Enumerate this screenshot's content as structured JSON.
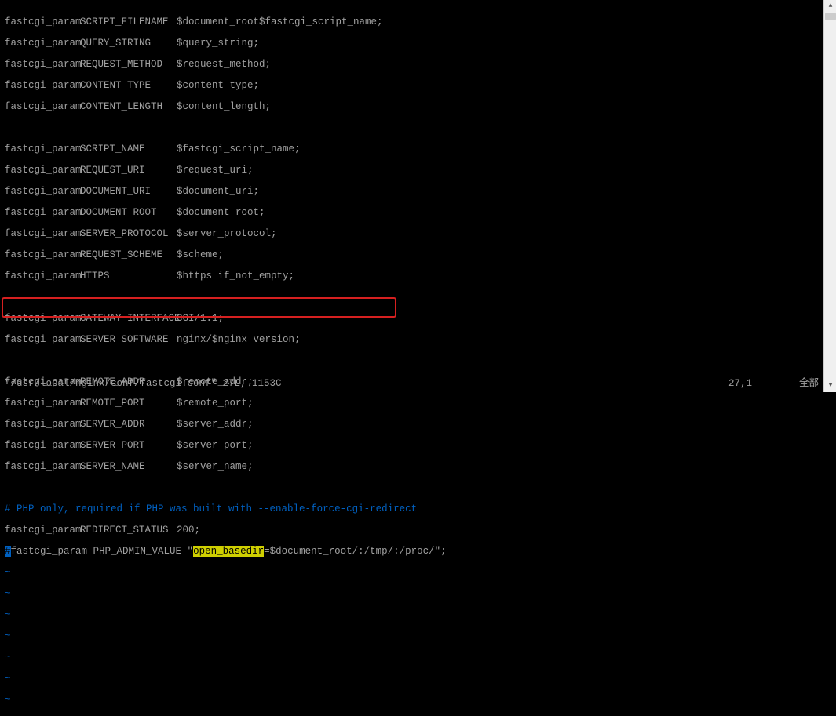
{
  "params": [
    {
      "k": "SCRIPT_FILENAME",
      "v": "$document_root$fastcgi_script_name;"
    },
    {
      "k": "QUERY_STRING",
      "v": "$query_string;"
    },
    {
      "k": "REQUEST_METHOD",
      "v": "$request_method;"
    },
    {
      "k": "CONTENT_TYPE",
      "v": "$content_type;"
    },
    {
      "k": "CONTENT_LENGTH",
      "v": "$content_length;"
    }
  ],
  "params2": [
    {
      "k": "SCRIPT_NAME",
      "v": "$fastcgi_script_name;"
    },
    {
      "k": "REQUEST_URI",
      "v": "$request_uri;"
    },
    {
      "k": "DOCUMENT_URI",
      "v": "$document_uri;"
    },
    {
      "k": "DOCUMENT_ROOT",
      "v": "$document_root;"
    },
    {
      "k": "SERVER_PROTOCOL",
      "v": "$server_protocol;"
    },
    {
      "k": "REQUEST_SCHEME",
      "v": "$scheme;"
    },
    {
      "k": "HTTPS",
      "v": "$https if_not_empty;"
    }
  ],
  "params3": [
    {
      "k": "GATEWAY_INTERFACE",
      "v": "CGI/1.1;"
    },
    {
      "k": "SERVER_SOFTWARE",
      "v": "nginx/$nginx_version;"
    }
  ],
  "params4": [
    {
      "k": "REMOTE_ADDR",
      "v": "$remote_addr;"
    },
    {
      "k": "REMOTE_PORT",
      "v": "$remote_port;"
    },
    {
      "k": "SERVER_ADDR",
      "v": "$server_addr;"
    },
    {
      "k": "SERVER_PORT",
      "v": "$server_port;"
    },
    {
      "k": "SERVER_NAME",
      "v": "$server_name;"
    }
  ],
  "directive": "fastcgi_param",
  "comment_line": "# PHP only, required if PHP was built with --enable-force-cgi-redirect",
  "redirect_line": {
    "k": "REDIRECT_STATUS",
    "v": "200;"
  },
  "edit_line": {
    "cursor_char": "#",
    "prefix": "fastcgi_param PHP_ADMIN_VALUE \"",
    "highlighted": "open_basedir",
    "suffix": "=$document_root/:/tmp/:/proc/\";"
  },
  "tilde": "~",
  "status": {
    "file": "\"/usr/local/nginx/conf/fastcgi.conf\" 27L, 1153C",
    "pos": "27,1",
    "pct": "全部"
  }
}
